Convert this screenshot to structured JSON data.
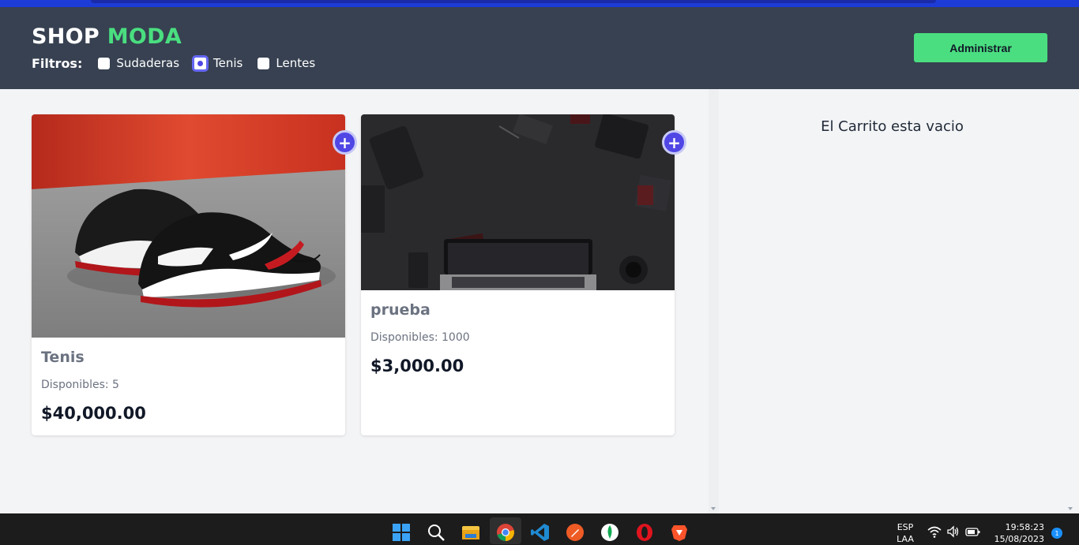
{
  "header": {
    "brand_main": "SHOP",
    "brand_accent": "MODA",
    "filters_label": "Filtros:",
    "filters": [
      {
        "label": "Sudaderas",
        "checked": false
      },
      {
        "label": "Tenis",
        "checked": true
      },
      {
        "label": "Lentes",
        "checked": false
      }
    ],
    "admin_button": "Administrar"
  },
  "products": [
    {
      "name": "Tenis",
      "stock": "Disponibles: 5",
      "price": "$40,000.00",
      "image": "sneakers-photo"
    },
    {
      "name": "prueba",
      "stock": "Disponibles: 1000",
      "price": "$3,000.00",
      "image": "laptop-desk-photo"
    }
  ],
  "cart": {
    "empty_text": "El Carrito esta vacio"
  },
  "taskbar": {
    "icons": [
      "windows-start-icon",
      "search-icon",
      "file-explorer-icon",
      "chrome-icon",
      "vscode-icon",
      "postman-icon",
      "mongodb-icon",
      "opera-icon",
      "brave-icon"
    ],
    "lang_top": "ESP",
    "lang_bottom": "LAA",
    "time": "19:58:23",
    "date": "15/08/2023",
    "notifications": "1"
  },
  "colors": {
    "header_bg": "#374151",
    "accent_green": "#4ade80",
    "indigo": "#4f46e5"
  }
}
